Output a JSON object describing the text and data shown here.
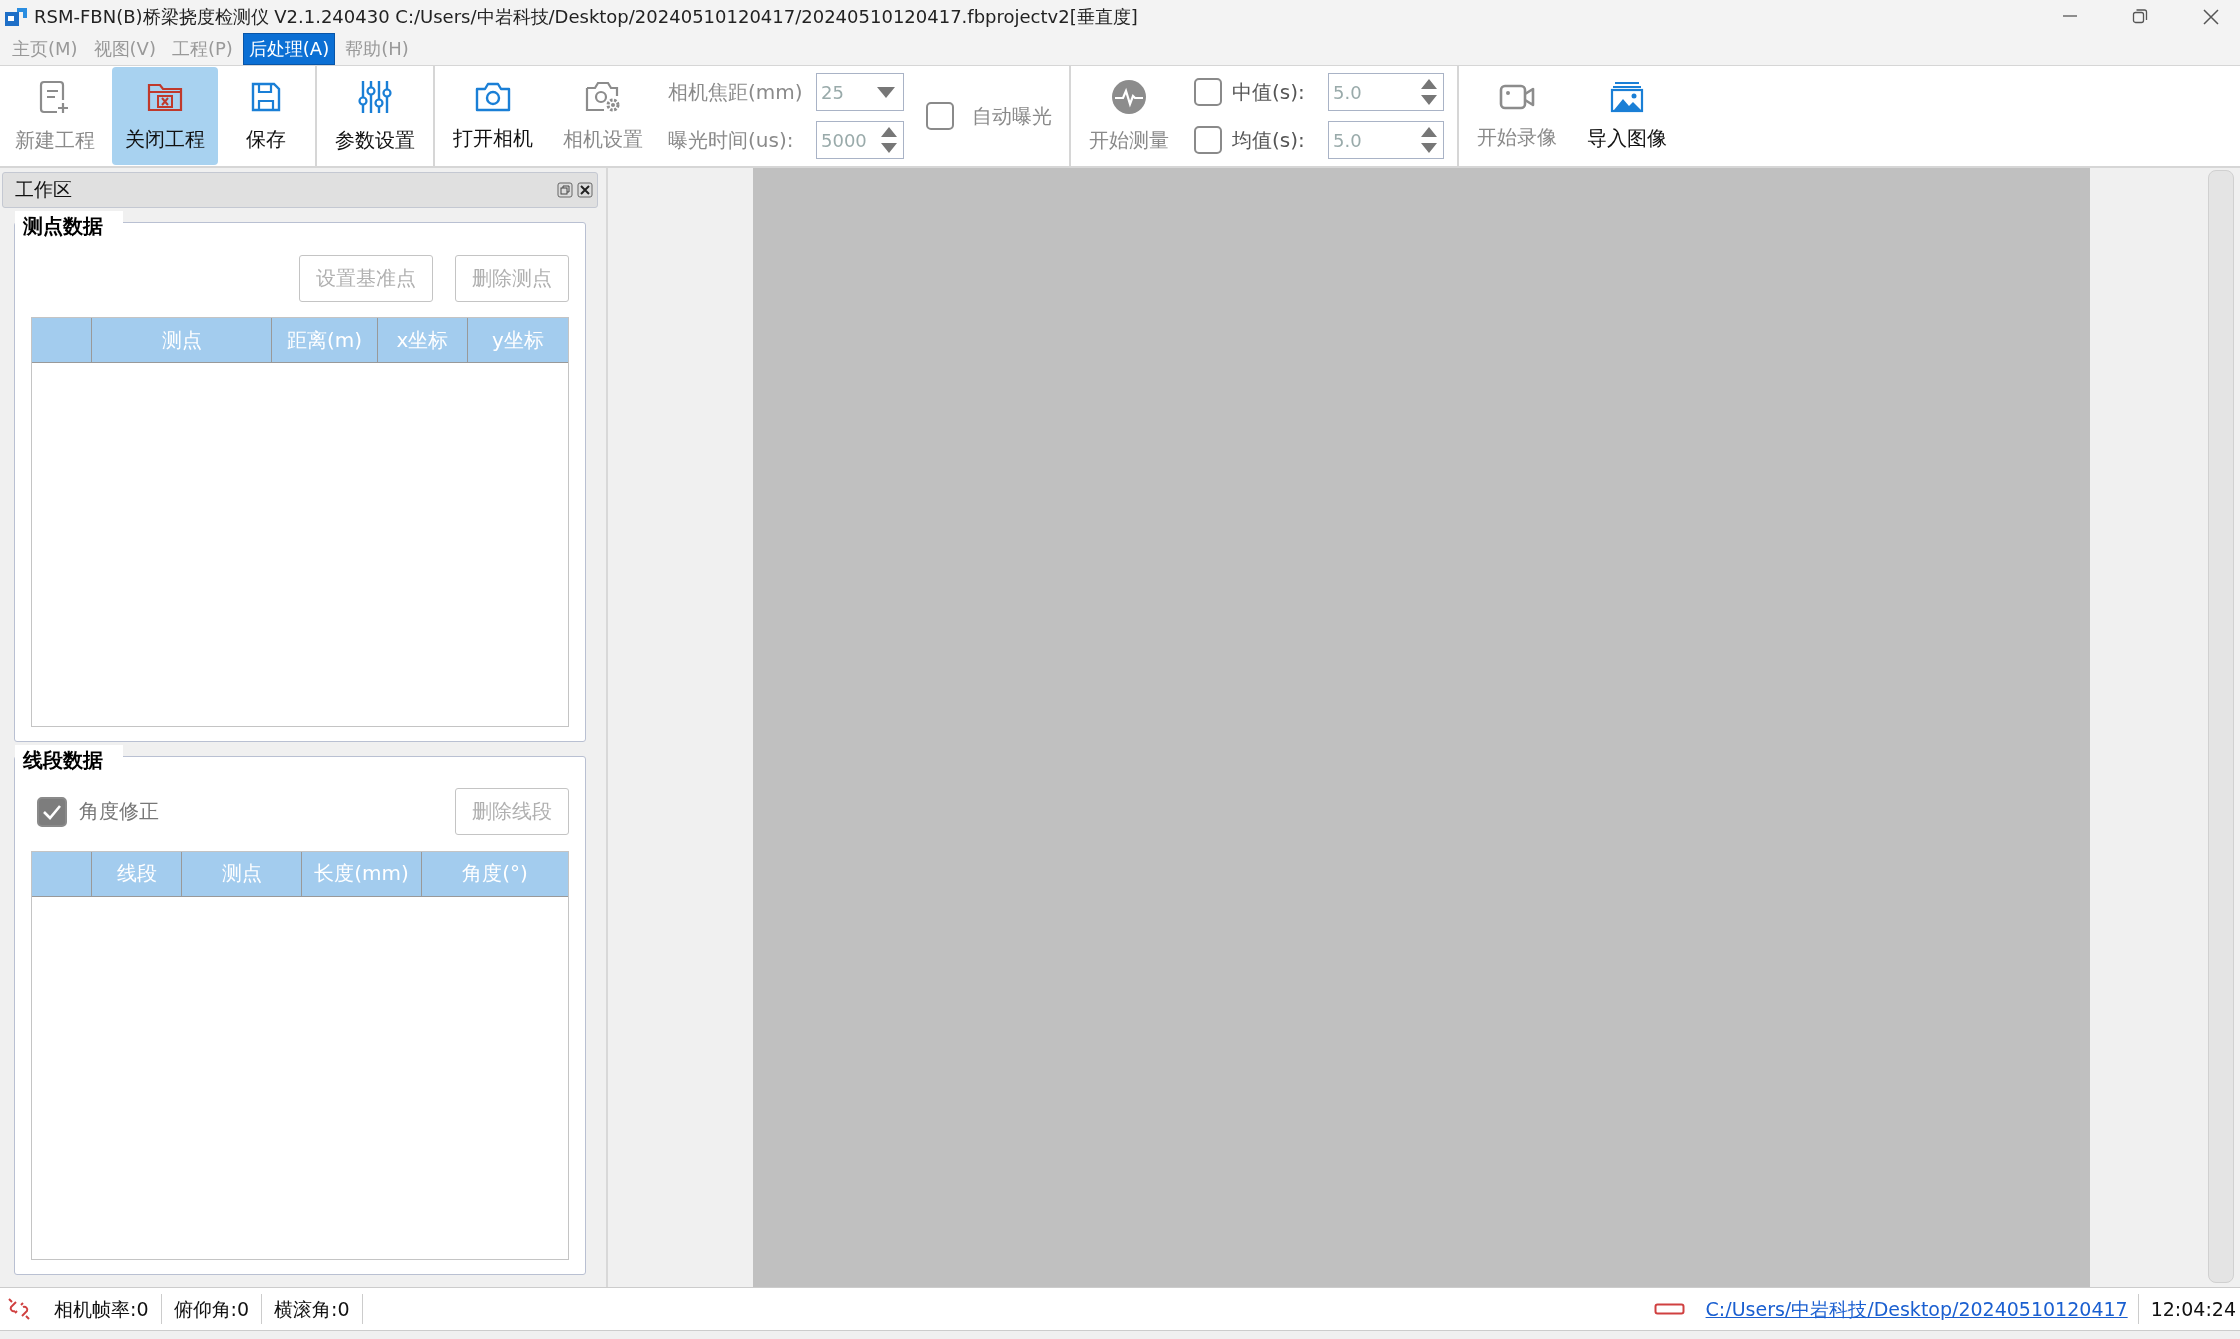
{
  "window": {
    "title": "RSM-FBN(B)桥梁挠度检测仪 V2.1.240430 C:/Users/中岩科技/Desktop/20240510120417/20240510120417.fbprojectv2[垂直度]"
  },
  "menu": [
    {
      "label": "主页(M)",
      "selected": false
    },
    {
      "label": "视图(V)",
      "selected": false
    },
    {
      "label": "工程(P)",
      "selected": false
    },
    {
      "label": "后处理(A)",
      "selected": true
    },
    {
      "label": "帮助(H)",
      "selected": false
    }
  ],
  "toolbar": [
    {
      "kind": "button",
      "label": "新建工程",
      "disabled": true,
      "selected": false
    },
    {
      "kind": "button",
      "label": "关闭工程",
      "disabled": false,
      "selected": true
    },
    {
      "kind": "button",
      "label": "保存",
      "disabled": false,
      "selected": false
    },
    {
      "kind": "separator"
    },
    {
      "kind": "button",
      "label": "参数设置",
      "disabled": false,
      "selected": false
    },
    {
      "kind": "separator"
    },
    {
      "kind": "button",
      "label": "打开相机",
      "disabled": false,
      "selected": false
    },
    {
      "kind": "button",
      "label": "相机设置",
      "disabled": true,
      "selected": false
    },
    {
      "kind": "fields",
      "disabled": true,
      "rows": [
        {
          "label": "相机焦距(mm)",
          "value": "25",
          "kind": "dropdown"
        },
        {
          "label": "曝光时间(us):",
          "value": "5000",
          "kind": "spin"
        }
      ]
    },
    {
      "kind": "check",
      "label": "自动曝光",
      "checked": false,
      "disabled": true
    },
    {
      "kind": "separator"
    },
    {
      "kind": "button",
      "label": "开始测量",
      "disabled": true,
      "selected": false
    },
    {
      "kind": "checkfields",
      "rows": [
        {
          "label": "中值(s):",
          "value": "5.0",
          "checked": false
        },
        {
          "label": "均值(s):",
          "value": "5.0",
          "checked": false
        }
      ]
    },
    {
      "kind": "separator"
    },
    {
      "kind": "button",
      "label": "开始录像",
      "disabled": true,
      "selected": false
    },
    {
      "kind": "button",
      "label": "导入图像",
      "disabled": false,
      "selected": false
    }
  ],
  "panel": {
    "title": "工作区",
    "groups": [
      {
        "title": "测点数据",
        "buttons": [
          {
            "label": "设置基准点",
            "disabled": true
          },
          {
            "label": "删除测点",
            "disabled": true
          }
        ],
        "table": {
          "columns": [
            "测点",
            "距离(m)",
            "x坐标",
            "y坐标"
          ]
        }
      },
      {
        "title": "线段数据",
        "checkbox": {
          "label": "角度修正",
          "checked": true,
          "disabled": true
        },
        "buttons": [
          {
            "label": "删除线段",
            "disabled": true
          }
        ],
        "table": {
          "columns": [
            "线段",
            "测点",
            "长度(mm)",
            "角度(°)"
          ]
        }
      }
    ]
  },
  "status_bar": {
    "items": [
      "相机帧率:0",
      "俯仰角:0",
      "横滚角:0"
    ],
    "path": "C:/Users/中岩科技/Desktop/20240510120417",
    "time": "12:04:24"
  }
}
